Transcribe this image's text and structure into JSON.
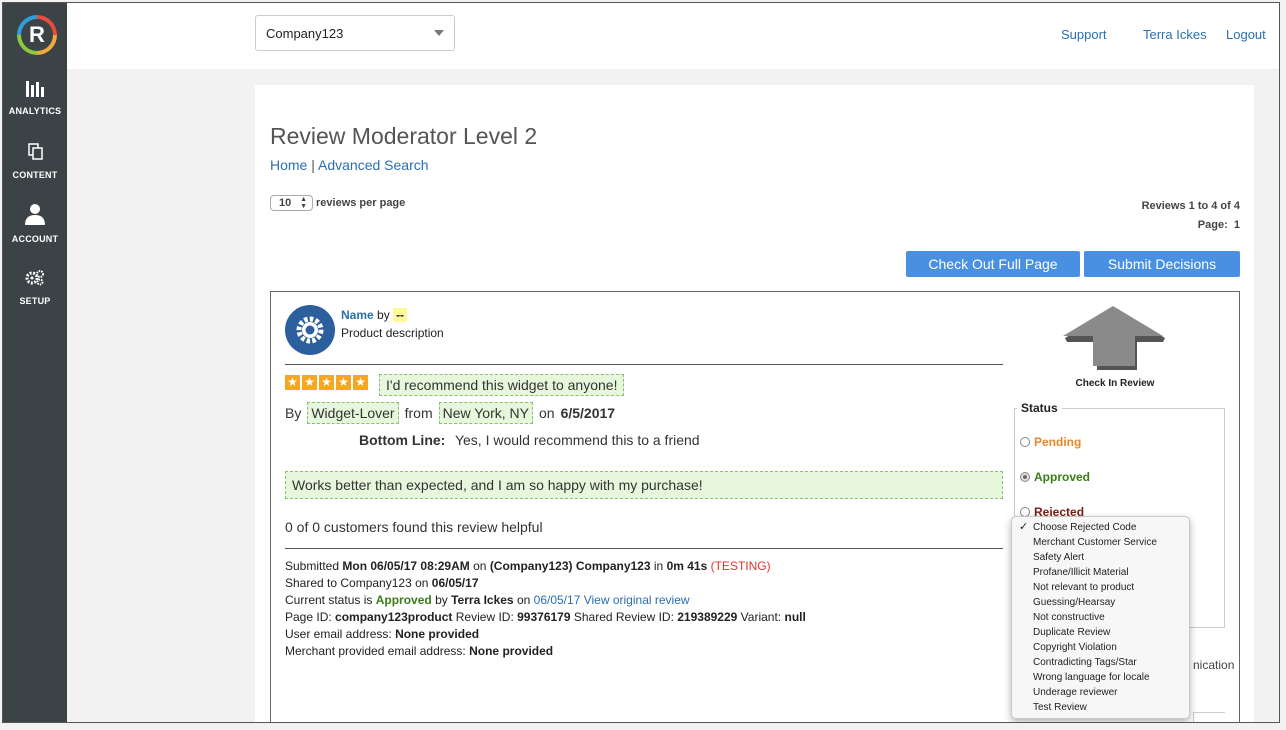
{
  "sidebar": {
    "logo_letter": "R",
    "items": [
      {
        "label": "ANALYTICS",
        "icon": "bar-chart-icon"
      },
      {
        "label": "CONTENT",
        "icon": "documents-icon"
      },
      {
        "label": "ACCOUNT",
        "icon": "user-icon"
      },
      {
        "label": "SETUP",
        "icon": "gears-icon"
      }
    ]
  },
  "topbar": {
    "company": "Company123",
    "links": [
      "Support",
      "Terra Ickes",
      "Logout"
    ]
  },
  "page": {
    "title": "Review Moderator Level 2",
    "breadcrumb_home": "Home",
    "breadcrumb_sep": "|",
    "breadcrumb_search": "Advanced Search",
    "per_page_value": "10",
    "per_page_label": "reviews per page",
    "reviews_count": "Reviews 1 to 4 of 4",
    "page_label": "Page:",
    "page_number": "1",
    "btn_checkout": "Check Out Full Page",
    "btn_submit": "Submit Decisions"
  },
  "review": {
    "name": "Name",
    "by": "by",
    "by_value": "--",
    "product_description": "Product description",
    "stars": [
      "★",
      "★",
      "★",
      "★",
      "★"
    ],
    "headline": "I'd recommend this widget to anyone!",
    "by_label": "By",
    "nickname": "Widget-Lover",
    "from_label": "from",
    "location": "New York, NY",
    "on_label": "on",
    "date": "6/5/2017",
    "bottom_line_label": "Bottom Line:",
    "bottom_line_value": "Yes, I would recommend this to a friend",
    "body": "Works better than expected, and I am so happy with my purchase!",
    "helpful": "0 of 0 customers found this review helpful",
    "meta": {
      "submitted_prefix": "Submitted",
      "submitted_date": "Mon 06/05/17 08:29AM",
      "submitted_on": "on",
      "submitted_company": "(Company123) Company123",
      "submitted_in": "in",
      "submitted_duration": "0m 41s",
      "testing": "(TESTING)",
      "shared_prefix": "Shared to Company123 on",
      "shared_date": "06/05/17",
      "status_prefix": "Current status is",
      "status_value": "Approved",
      "status_by": "by",
      "status_user": "Terra Ickes",
      "status_on": "on",
      "status_date": "06/05/17",
      "view_original": "View original review",
      "page_id_label": "Page ID:",
      "page_id": "company123product",
      "review_id_label": "Review ID:",
      "review_id": "99376179",
      "shared_review_id_label": "Shared Review ID:",
      "shared_review_id": "219389229",
      "variant_label": "Variant:",
      "variant": "null",
      "user_email_label": "User email address:",
      "user_email": "None provided",
      "merchant_email_label": "Merchant provided email address:",
      "merchant_email": "None provided"
    }
  },
  "moderation": {
    "check_in_label": "Check In Review",
    "status_legend": "Status",
    "statuses": [
      {
        "label": "Pending",
        "color": "#e8872a",
        "selected": false
      },
      {
        "label": "Approved",
        "color": "#3a7d17",
        "selected": true
      },
      {
        "label": "Rejected",
        "color": "#7a1f12",
        "selected": false
      }
    ],
    "partial_text": "nication",
    "reject_codes": [
      "Choose Rejected Code",
      "Merchant Customer Service",
      "Safety Alert",
      "Profane/Illicit Material",
      "Not relevant to product",
      "Guessing/Hearsay",
      "Not constructive",
      "Duplicate Review",
      "Copyright Violation",
      "Contradicting Tags/Star",
      "Wrong language for locale",
      "Underage reviewer",
      "Test Review"
    ],
    "reject_selected_index": 0,
    "check_mark": "✓"
  }
}
